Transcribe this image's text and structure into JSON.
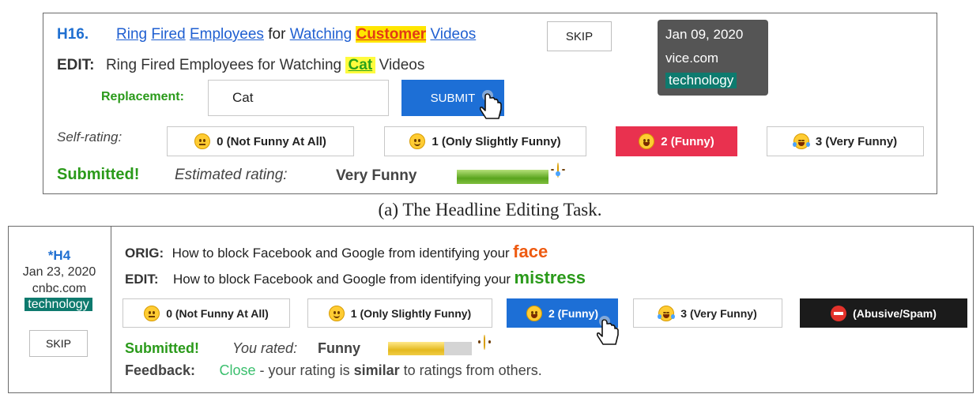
{
  "panel_a": {
    "headline_id": "H16.",
    "headline_words": [
      "Ring",
      "Fired",
      "Employees",
      "for",
      "Watching",
      "Customer",
      "Videos"
    ],
    "edit_label": "EDIT:",
    "edit_before": "Ring Fired Employees for Watching",
    "edit_replacement": "Cat",
    "edit_after": "Videos",
    "skip_label": "SKIP",
    "tooltip": {
      "date": "Jan 09, 2020",
      "source": "vice.com",
      "category": "technology"
    },
    "replacement_label": "Replacement:",
    "replacement_value": "Cat",
    "submit_label": "SUBMIT",
    "self_rating_label": "Self-rating:",
    "ratings": [
      "0 (Not Funny At All)",
      "1 (Only Slightly Funny)",
      "2 (Funny)",
      "3 (Very Funny)"
    ],
    "selected_rating": 2,
    "submitted_label": "Submitted!",
    "estimated_label": "Estimated rating:",
    "estimated_value": "Very Funny",
    "estimated_bar_fraction": 1.0,
    "caption": "(a) The Headline Editing Task."
  },
  "panel_b": {
    "headline_id": "*H4",
    "date": "Jan 23, 2020",
    "source": "cnbc.com",
    "category": "technology",
    "skip_label": "SKIP",
    "orig_label": "ORIG:",
    "orig_text": "How to block Facebook and Google from identifying your",
    "orig_word": "face",
    "edit_label": "EDIT:",
    "edit_text": "How to block Facebook and Google from identifying your",
    "edit_word": "mistress",
    "ratings": [
      "0 (Not Funny At All)",
      "1 (Only Slightly Funny)",
      "2 (Funny)",
      "3 (Very Funny)",
      "(Abusive/Spam)"
    ],
    "selected_rating": 2,
    "submitted_label": "Submitted!",
    "you_rated_label": "You rated:",
    "you_rated_value": "Funny",
    "rated_bar_fraction": 0.67,
    "feedback_label": "Feedback:",
    "feedback_close": "Close",
    "feedback_mid": " - your rating is ",
    "feedback_similar": "similar",
    "feedback_end": " to ratings from others."
  },
  "colors": {
    "link_blue": "#1f5fd1",
    "submit_blue": "#1d6fd6",
    "funny_red": "#e9314f",
    "submitted_green": "#2a9a1a",
    "teal_tag": "#0e7a6e",
    "highlight_yellow": "#ffe600"
  }
}
